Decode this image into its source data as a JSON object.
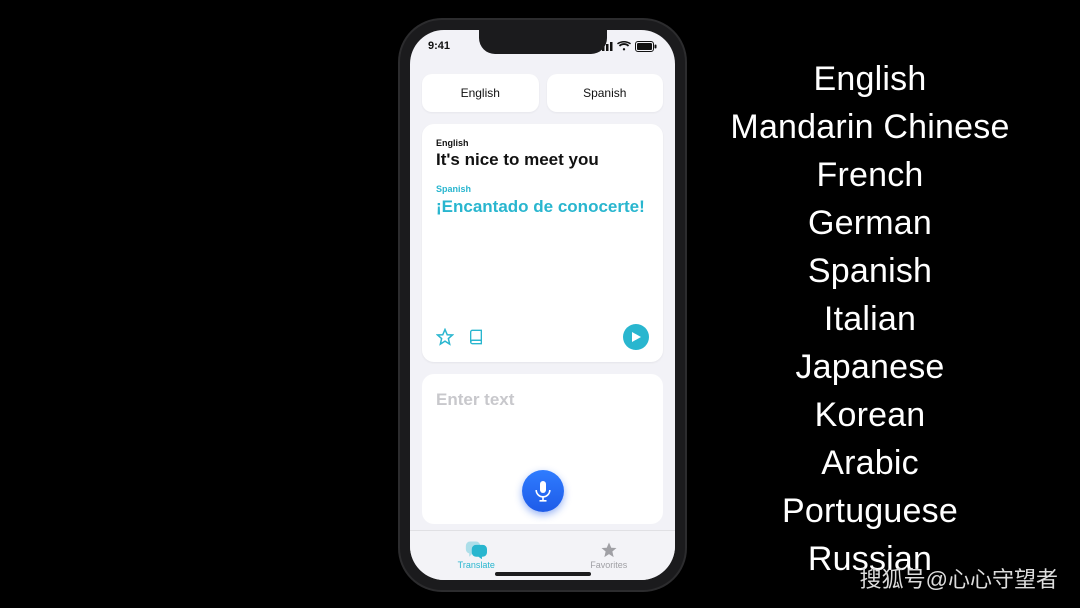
{
  "status": {
    "time": "9:41"
  },
  "selectors": {
    "source": "English",
    "target": "Spanish"
  },
  "translation": {
    "sourceLabel": "English",
    "sourceText": "It's nice to meet you",
    "targetLabel": "Spanish",
    "targetText": "¡Encantado de conocerte!"
  },
  "input": {
    "placeholder": "Enter text"
  },
  "tabs": {
    "translate": "Translate",
    "favorites": "Favorites"
  },
  "languages": [
    "English",
    "Mandarin Chinese",
    "French",
    "German",
    "Spanish",
    "Italian",
    "Japanese",
    "Korean",
    "Arabic",
    "Portuguese",
    "Russian"
  ],
  "watermark": "搜狐号@心心守望者",
  "colors": {
    "accent": "#29b6cf",
    "micTop": "#2f7cff",
    "micBottom": "#1e5be8"
  }
}
